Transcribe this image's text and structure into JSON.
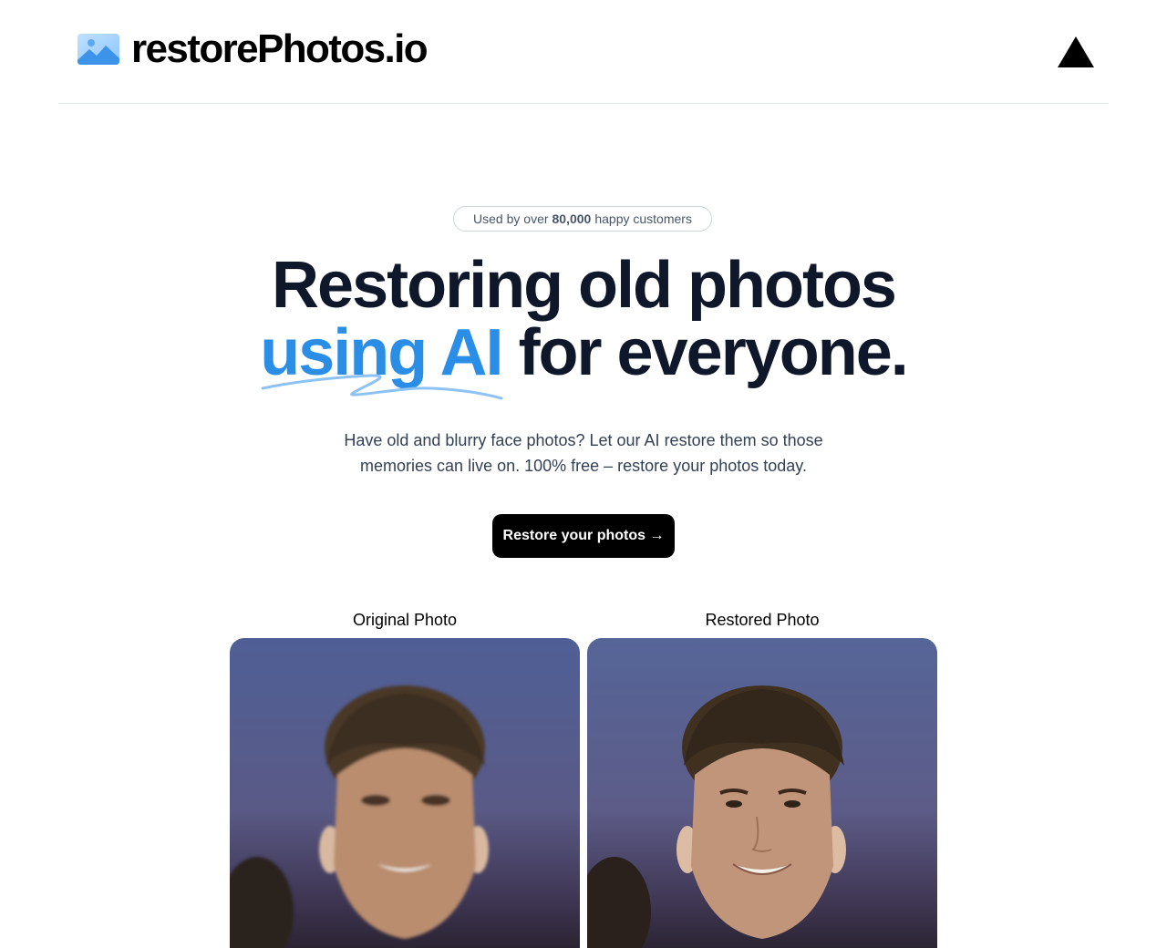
{
  "header": {
    "logo_text": "restorePhotos.io",
    "logo_icon": "photo-icon",
    "right_icon": "vercel-triangle-icon"
  },
  "hero": {
    "badge_prefix": "Used by over",
    "badge_count": "80,000",
    "badge_suffix": "happy customers",
    "headline_line1": "Restoring old photos",
    "headline_accent": "using AI",
    "headline_rest": "for everyone.",
    "subtext": "Have old and blurry face photos? Let our AI restore them so those memories can live on. 100% free – restore your photos today.",
    "cta_label": "Restore your photos →"
  },
  "comparison": {
    "original_label": "Original Photo",
    "restored_label": "Restored Photo"
  },
  "colors": {
    "accent": "#2b8ee6",
    "headline": "#0f172a",
    "cta_bg": "#000000"
  }
}
